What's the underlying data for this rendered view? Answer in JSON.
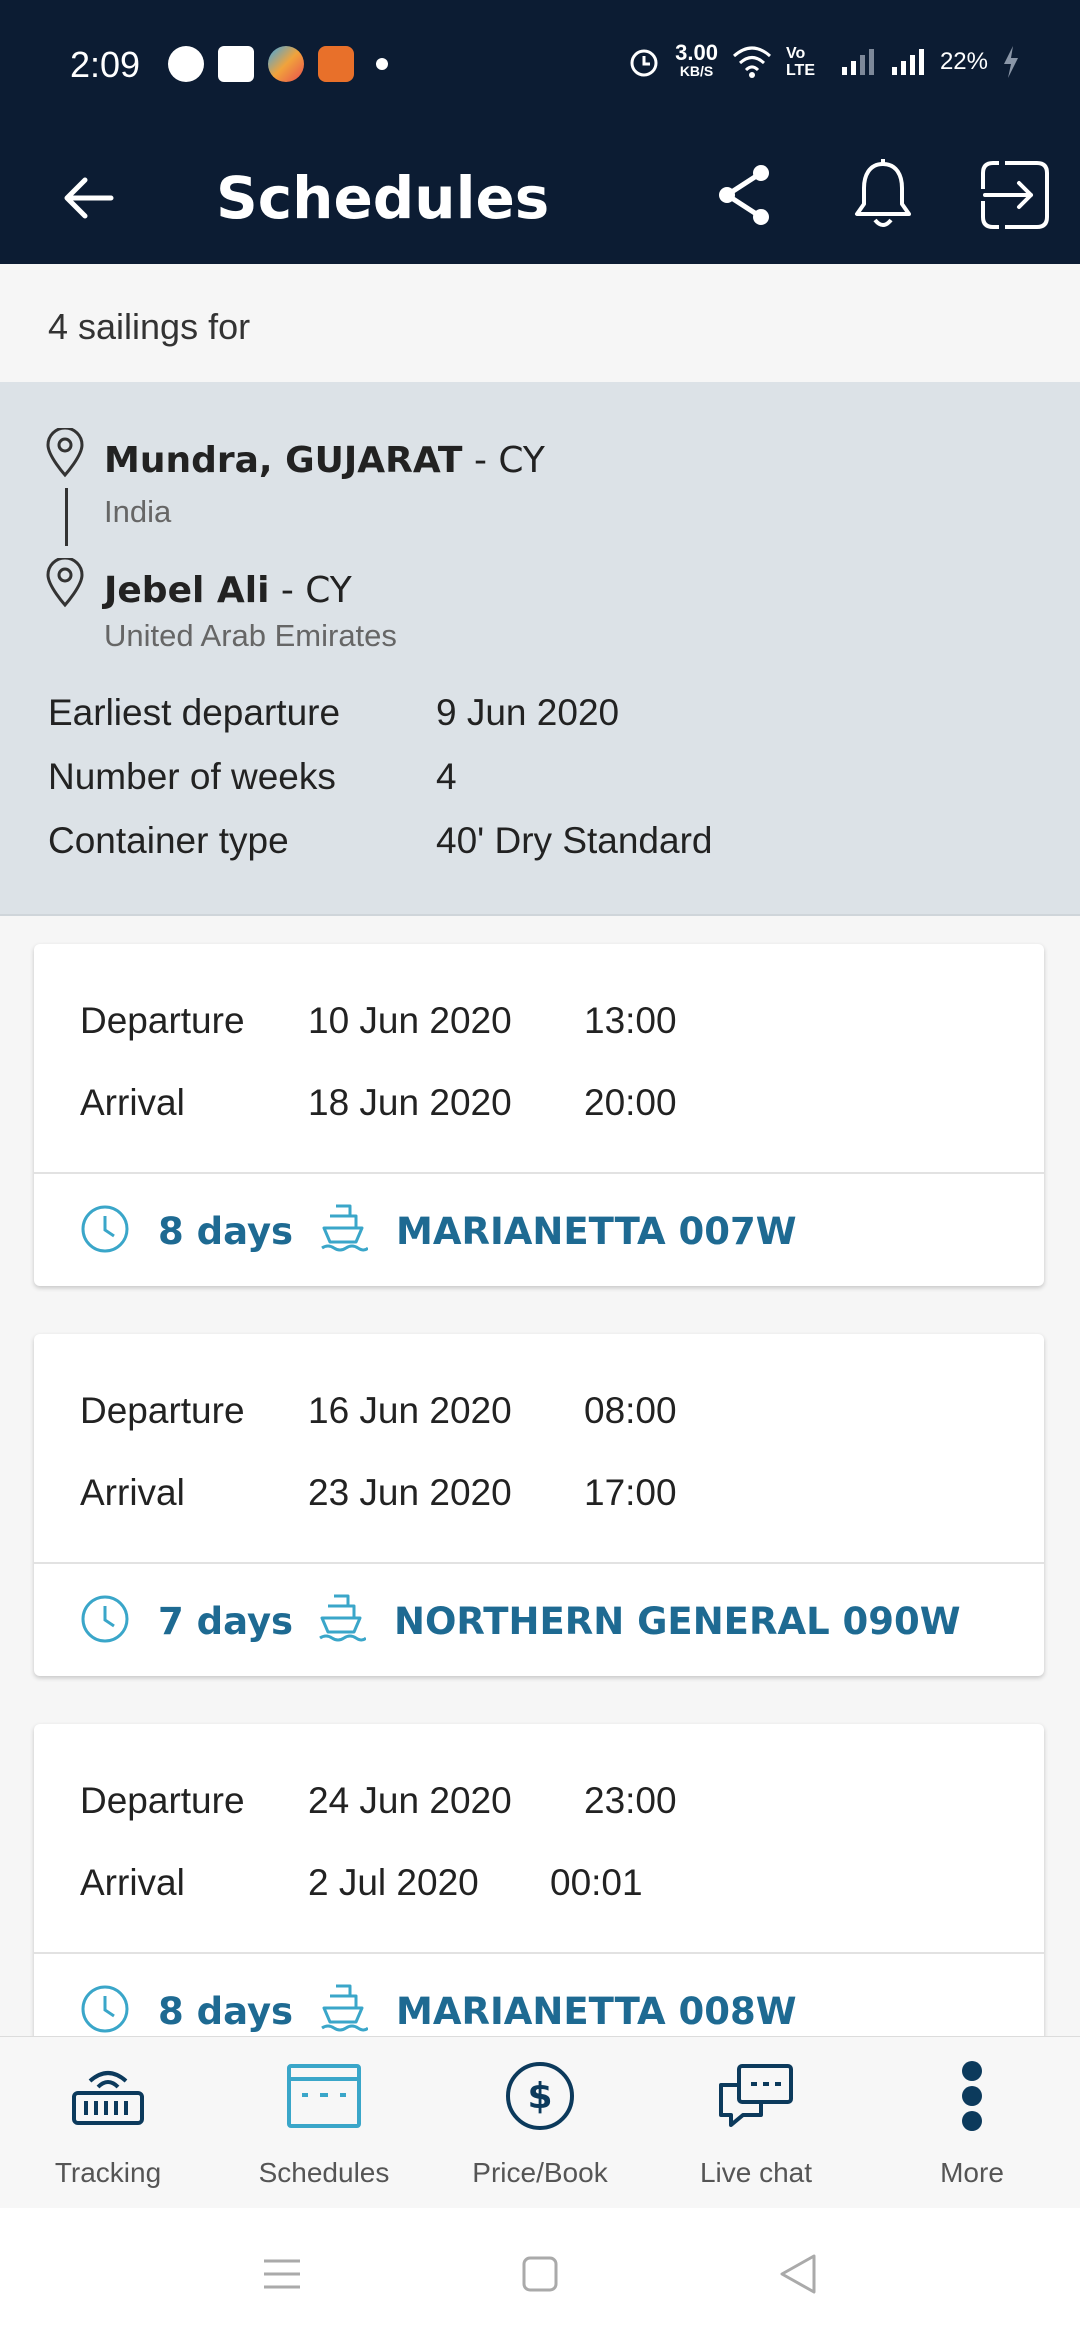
{
  "status_bar": {
    "time": "2:09",
    "network_speed": "3.00",
    "network_speed_unit": "KB/S",
    "volte_label": "Vo LTE",
    "battery": "22%"
  },
  "header": {
    "title": "Schedules"
  },
  "summary": {
    "sailings_text": "4 sailings for",
    "origin": {
      "name": "Mundra, GUJARAT",
      "type": " - CY",
      "country": "India"
    },
    "destination": {
      "name": "Jebel Ali",
      "type": " - CY",
      "country": "United Arab Emirates"
    },
    "params": [
      {
        "label": "Earliest departure",
        "value": "9 Jun 2020"
      },
      {
        "label": "Number of weeks",
        "value": "4"
      },
      {
        "label": "Container type",
        "value": "40' Dry Standard"
      }
    ]
  },
  "departure_label": "Departure",
  "arrival_label": "Arrival",
  "sailings": [
    {
      "dep_date": "10 Jun 2020",
      "dep_time": "13:00",
      "arr_date": "18 Jun 2020",
      "arr_time": "20:00",
      "duration": "8 days",
      "vessel": "MARIANETTA 007W"
    },
    {
      "dep_date": "16 Jun 2020",
      "dep_time": "08:00",
      "arr_date": "23 Jun 2020",
      "arr_time": "17:00",
      "duration": "7 days",
      "vessel": "NORTHERN GENERAL 090W"
    },
    {
      "dep_date": "24 Jun 2020",
      "dep_time": "23:00",
      "arr_date": "2 Jul 2020",
      "arr_time": "00:01",
      "duration": "8 days",
      "vessel": "MARIANETTA 008W"
    }
  ],
  "bottom_nav": [
    {
      "label": "Tracking",
      "icon": "tracking-icon"
    },
    {
      "label": "Schedules",
      "icon": "schedules-icon"
    },
    {
      "label": "Price/Book",
      "icon": "price-icon"
    },
    {
      "label": "Live chat",
      "icon": "chat-icon"
    },
    {
      "label": "More",
      "icon": "more-icon"
    }
  ],
  "colors": {
    "header_bg": "#0c1c33",
    "accent": "#1e6a92",
    "icon_teal": "#3aa6c9",
    "summary_bg": "#dce2e7"
  }
}
